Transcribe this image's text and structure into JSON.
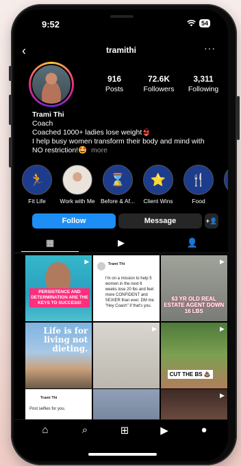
{
  "status": {
    "time": "9:52",
    "battery": "54"
  },
  "header": {
    "username": "tramithi",
    "back_icon": "‹",
    "more_icon": "···"
  },
  "profile": {
    "stats": [
      {
        "num": "916",
        "label": "Posts"
      },
      {
        "num": "72.6K",
        "label": "Followers"
      },
      {
        "num": "3,311",
        "label": "Following"
      }
    ],
    "name": "Trami Thi",
    "category": "Coach",
    "bio_line1": "Coached 1000+ ladies lose weight👙",
    "bio_line2": "I help busy women transform their body and mind with NO restriction!🤩",
    "more": "more"
  },
  "highlights": [
    {
      "label": "Fit Life",
      "icon": "🏃"
    },
    {
      "label": "Work with Me",
      "icon": ""
    },
    {
      "label": "Before & Af...",
      "icon": "⌛"
    },
    {
      "label": "Client Wins",
      "icon": "⭐"
    },
    {
      "label": "Food",
      "icon": "🍴"
    }
  ],
  "actions": {
    "follow": "Follow",
    "message": "Message",
    "add_user": "+👤"
  },
  "tabs": {
    "grid": "▦",
    "reels": "▶",
    "tagged": "👤"
  },
  "posts": {
    "p1_caption": "PERSISTENCE AND DETERMINATION ARE THE KEYS TO SUCCESS!",
    "p2_author": "Trami Thi",
    "p2_text": "I'm on a mission to help 5 women in the next 6 weeks lose 20 lbs and feel more CONFIDENT and SEXIER than ever. DM me \"Hey Coach\" if that's you.",
    "p3_caption": "63 YR OLD REAL ESTATE AGENT DOWN 16 LBS",
    "p4_caption": "Life is for living not dieting.",
    "p6_caption": "CUT THE BS 💩",
    "p7_author": "Trami Thi",
    "p7_text": "Post selfies for you."
  },
  "nav": {
    "home": "⌂",
    "search": "⌕",
    "create": "⊞",
    "reels": "▶",
    "profile": "●"
  },
  "colors": {
    "follow": "#1d8ef5",
    "background": "#000000"
  }
}
